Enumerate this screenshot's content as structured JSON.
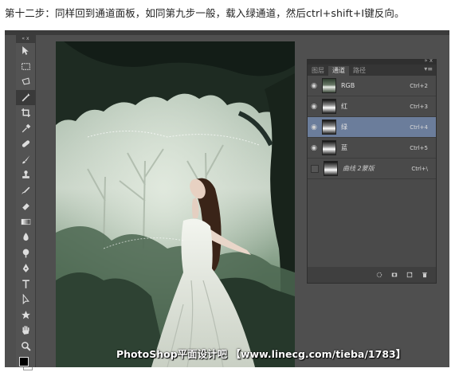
{
  "caption": "第十二步：同样回到通道面板，如同第九步一般，载入绿通道，然后ctrl+shift+I键反向。",
  "toolbar": {
    "header": "« x",
    "tools": [
      "move-icon",
      "marquee-icon",
      "lasso-icon",
      "magic-wand-icon",
      "crop-icon",
      "eyedropper-icon",
      "healing-brush-icon",
      "brush-icon",
      "clone-stamp-icon",
      "history-brush-icon",
      "eraser-icon",
      "gradient-icon",
      "blur-icon",
      "dodge-icon",
      "pen-icon",
      "type-icon",
      "path-selection-icon",
      "shape-icon",
      "hand-icon",
      "zoom-icon"
    ],
    "active_tool": "magic-wand-icon"
  },
  "panel": {
    "collapse": "» x",
    "tabs": [
      "图层",
      "通道",
      "路径"
    ],
    "active_tab": "通道",
    "menu": "▾≡",
    "channels": [
      {
        "name": "RGB",
        "shortcut": "Ctrl+2",
        "visible": true,
        "selected": false
      },
      {
        "name": "红",
        "shortcut": "Ctrl+3",
        "visible": true,
        "selected": false
      },
      {
        "name": "绿",
        "shortcut": "Ctrl+4",
        "visible": true,
        "selected": true
      },
      {
        "name": "蓝",
        "shortcut": "Ctrl+5",
        "visible": true,
        "selected": false
      },
      {
        "name": "曲线 2蒙版",
        "shortcut": "Ctrl+\\",
        "visible": false,
        "selected": false
      }
    ],
    "footer_icons": [
      "load-selection-icon",
      "save-selection-icon",
      "new-channel-icon",
      "delete-channel-icon"
    ]
  },
  "canvas": {
    "watermark": "PhotoShop平面设计吧 【www.linecg.com/tieba/1783】"
  },
  "colors": {
    "workspace": "#4f4f4f",
    "panel": "#4a4a4a",
    "selected_row": "#6b7d9b"
  }
}
